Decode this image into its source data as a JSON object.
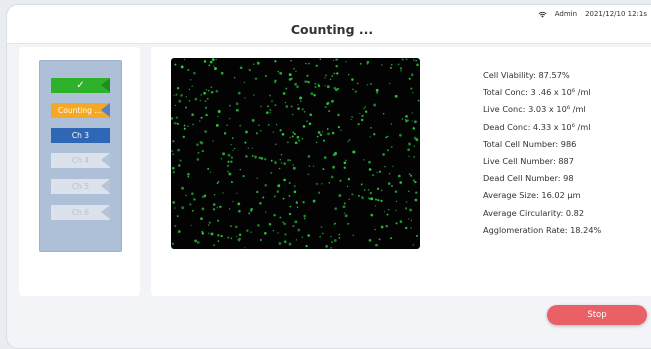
{
  "header": {
    "title": "Counting ...",
    "user": "Admin",
    "datetime": "2021/12/10 12:1⁠s"
  },
  "channels": [
    {
      "label": "✓",
      "state": "done"
    },
    {
      "label": "Counting ...",
      "state": "counting"
    },
    {
      "label": "Ch 3",
      "state": "active"
    },
    {
      "label": "Ch 4",
      "state": "disabled"
    },
    {
      "label": "Ch 5",
      "state": "disabled"
    },
    {
      "label": "Ch 6",
      "state": "disabled"
    }
  ],
  "results": {
    "viability": "Cell Viability:  87.57%",
    "total_conc": "Total Conc:  3 .46 x 10⁶ /ml",
    "live_conc": "Live Conc:  3.03 x 10⁶ /ml",
    "dead_conc": "Dead Conc:  4.33 x 10⁶ /ml",
    "total_number": "Total Cell Number:  986",
    "live_number": "Live Cell Number:  887",
    "dead_number": "Dead Cell Number:  98",
    "avg_size": "Average Size:  16.02 µm",
    "avg_circularity": "Average Circularity:  0.82",
    "agglomeration": "Agglomeration Rate:  18.24%"
  },
  "actions": {
    "stop_label": "Stop"
  },
  "colors": {
    "cell_dot": "#2ecc40",
    "stop": "#e96067",
    "counting": "#f4a825",
    "active": "#2f66b6",
    "done": "#2eb12b"
  }
}
